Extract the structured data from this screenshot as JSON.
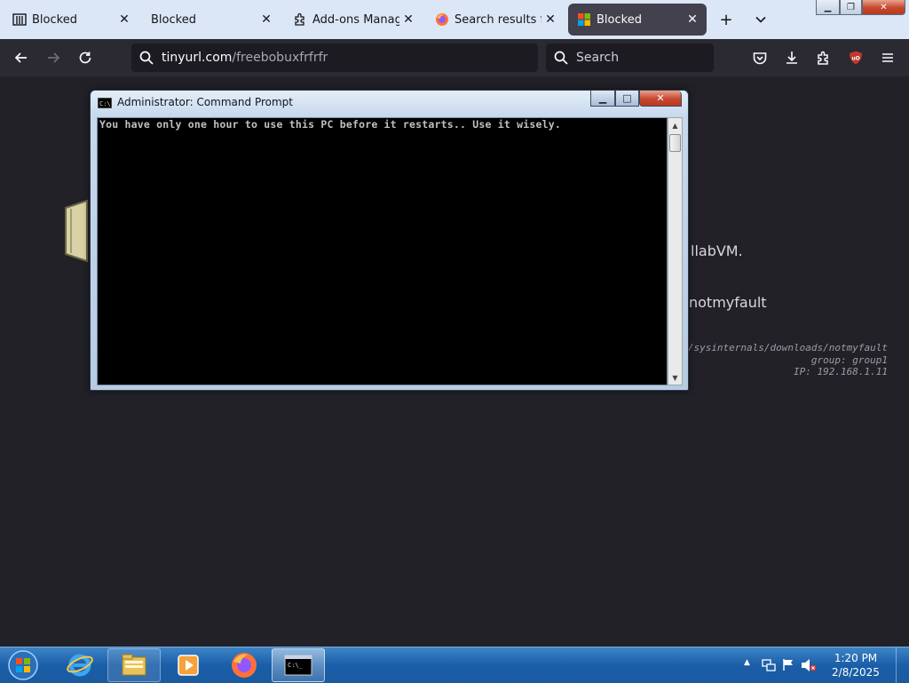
{
  "browser": {
    "tabs": [
      {
        "title": "Blocked",
        "icon": "library-icon",
        "active": false
      },
      {
        "title": "Blocked",
        "icon": "",
        "active": false
      },
      {
        "title": "Add-ons Manager",
        "icon": "puzzle-icon",
        "active": false
      },
      {
        "title": "Search results for “",
        "icon": "firefox-icon",
        "active": false
      },
      {
        "title": "Blocked",
        "icon": "windows-logo-icon",
        "active": true
      }
    ],
    "url_host": "tinyurl.com",
    "url_path": "/freebobuxfrfrfr",
    "search_placeholder": "Search",
    "colors": {
      "tabstrip": "#dbe7f6",
      "navbar": "#2b2a33",
      "page": "#222128",
      "ublock": "#c0392b"
    }
  },
  "page": {
    "text_collabvm": "llabVM.",
    "text_notmyfault": "notmyfault",
    "text_url": "-us/sysinternals/downloads/notmyfault",
    "text_group": "group: group1",
    "text_ip": "IP: 192.168.1.11"
  },
  "cmd": {
    "title": "Administrator: Command Prompt",
    "output": "You have only one hour to use this PC before it restarts.. Use it wisely."
  },
  "taskbar": {
    "items": [
      "internet-explorer-icon",
      "file-explorer-icon",
      "media-player-icon",
      "firefox-icon",
      "command-prompt-icon"
    ],
    "clock_time": "1:20 PM",
    "clock_date": "2/8/2025"
  }
}
